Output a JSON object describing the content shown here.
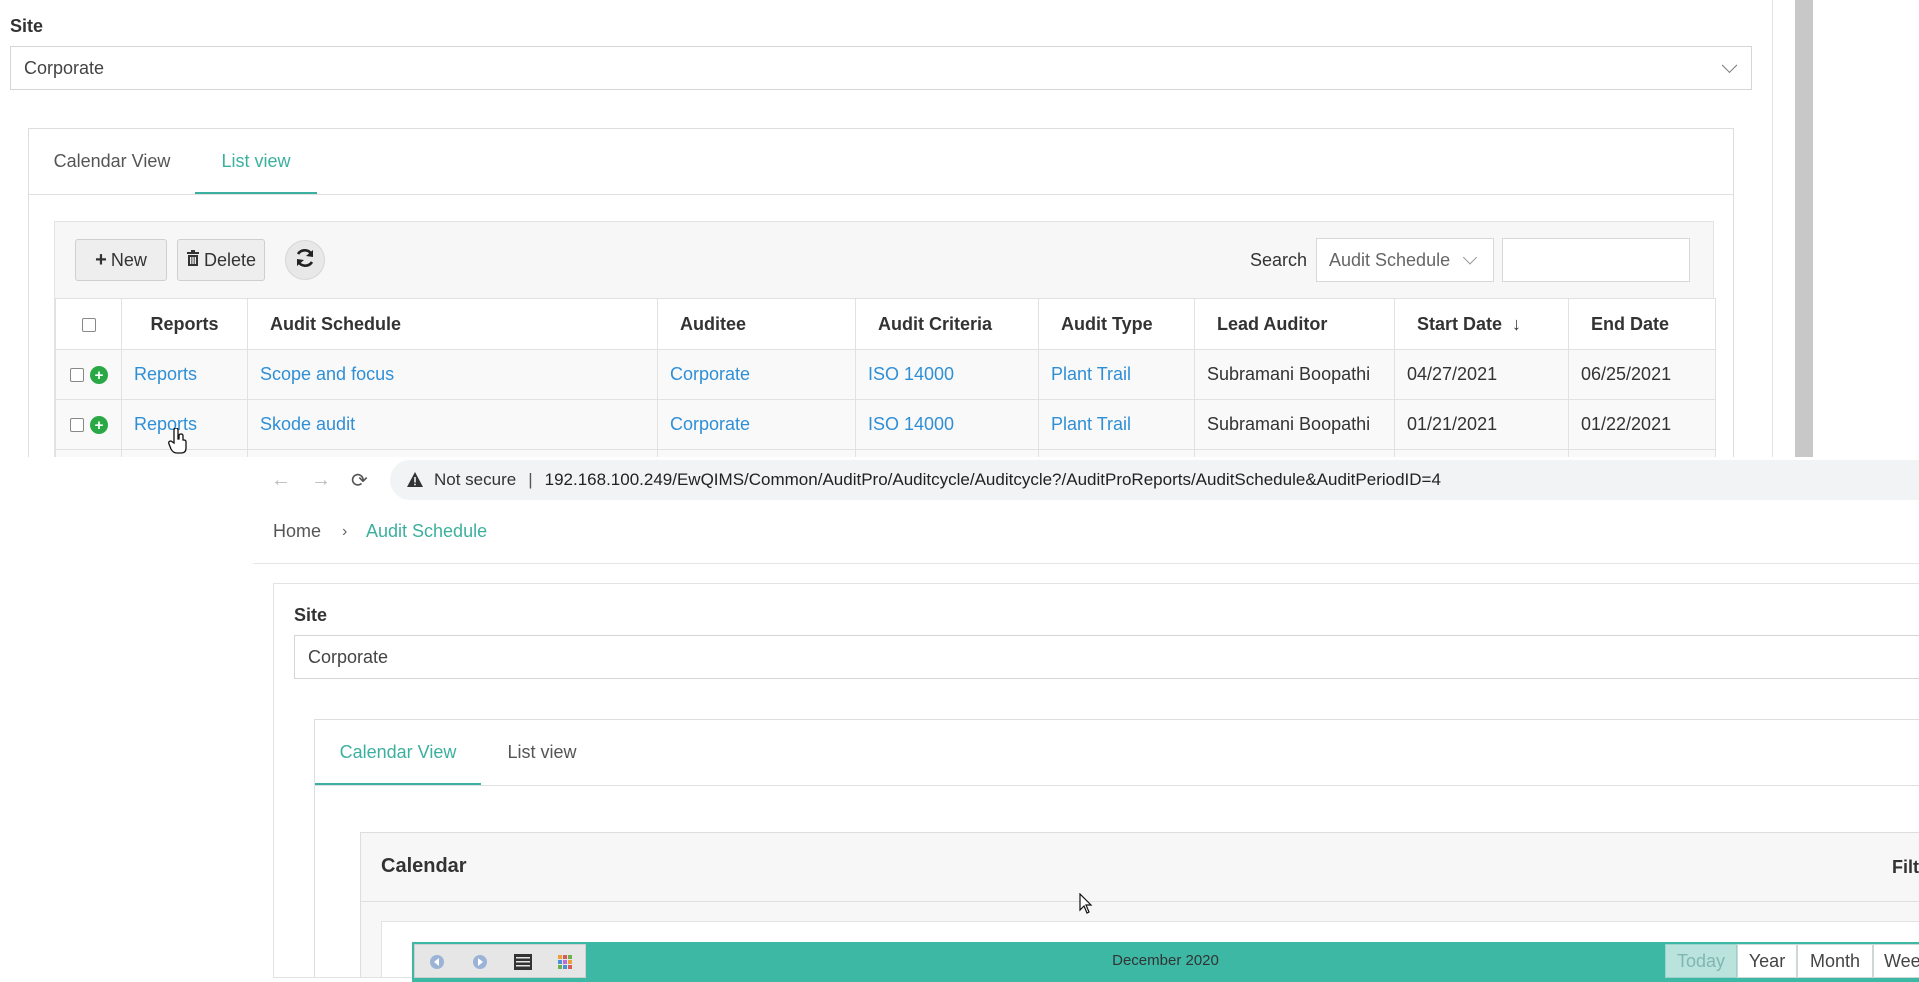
{
  "top_window": {
    "site_label": "Site",
    "site_value": "Corporate",
    "tabs": [
      {
        "label": "Calendar View",
        "active": false
      },
      {
        "label": "List view",
        "active": true
      }
    ],
    "toolbar": {
      "new_label": "New",
      "delete_label": "Delete",
      "search_label": "Search",
      "search_field": "Audit Schedule",
      "search_value": ""
    },
    "table": {
      "columns": [
        "Reports",
        "Audit Schedule",
        "Auditee",
        "Audit Criteria",
        "Audit Type",
        "Lead Auditor",
        "Start Date",
        "End Date"
      ],
      "sort_indicator": "↓",
      "rows": [
        {
          "reports": "Reports",
          "schedule": "Scope and focus",
          "auditee": "Corporate",
          "criteria": "ISO 14000",
          "type": "Plant Trail",
          "lead": "Subramani Boopathi",
          "start": "04/27/2021",
          "end": "06/25/2021"
        },
        {
          "reports": "Reports",
          "schedule": "Skode audit",
          "auditee": "Corporate",
          "criteria": "ISO 14000",
          "type": "Plant Trail",
          "lead": "Subramani Boopathi",
          "start": "01/21/2021",
          "end": "01/22/2021"
        }
      ]
    }
  },
  "browser": {
    "not_secure": "Not secure",
    "separator": "|",
    "url": "192.168.100.249/EwQIMS/Common/AuditPro/Auditcycle/Auditcycle?/AuditProReports/AuditSchedule&AuditPeriodID=4"
  },
  "bottom_window": {
    "breadcrumb": {
      "home": "Home",
      "current": "Audit Schedule"
    },
    "site_label": "Site",
    "site_value": "Corporate",
    "tabs": [
      {
        "label": "Calendar View",
        "active": true
      },
      {
        "label": "List view",
        "active": false
      }
    ],
    "calendar": {
      "title": "Calendar",
      "filter_label": "Filt",
      "month_label": "December 2020",
      "view_buttons": [
        "Today",
        "Year",
        "Month",
        "Wee"
      ]
    }
  },
  "colors": {
    "accent": "#3cb09e",
    "link": "#2f8fd6",
    "add_badge": "#2aa845",
    "calendar_bar": "#3cb8a5"
  }
}
